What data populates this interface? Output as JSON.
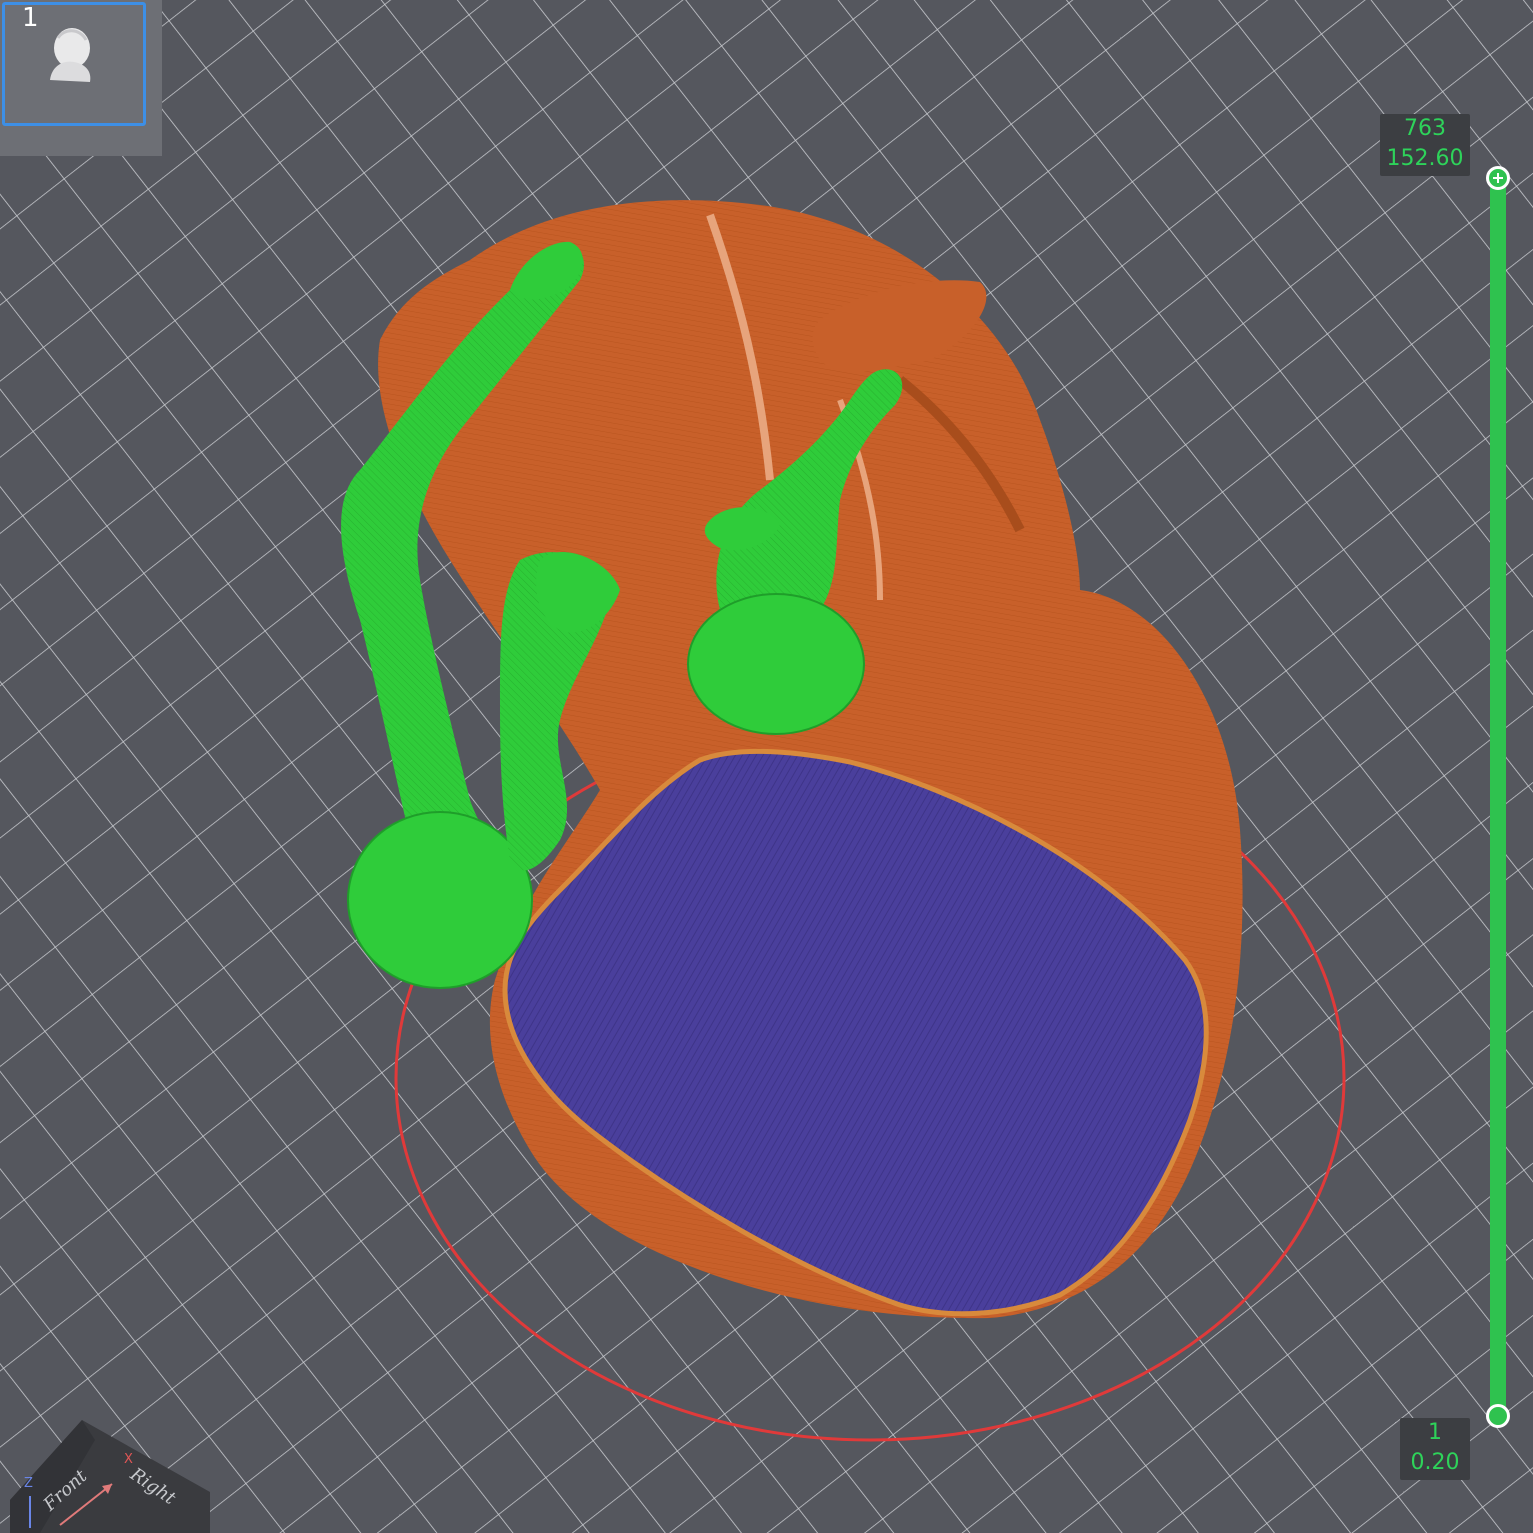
{
  "plate": {
    "number": "1",
    "thumbnail_icon": "bust-model-icon"
  },
  "layer_slider": {
    "top": {
      "layer": "763",
      "height": "152.60"
    },
    "bottom": {
      "layer": "1",
      "height": "0.20"
    },
    "track_color": "#2fc24f"
  },
  "view_cube": {
    "front_label": "Front",
    "right_label": "Right",
    "x_axis_label": "X",
    "z_axis_label": "Z"
  },
  "scene": {
    "model_color": "#c8602a",
    "support_color": "#2fcc3a",
    "top_surface_color": "#4a3f9c",
    "selection_outline_color": "#e03a3a",
    "grid_color": "#c9cbd0",
    "background_color": "#55575e"
  }
}
